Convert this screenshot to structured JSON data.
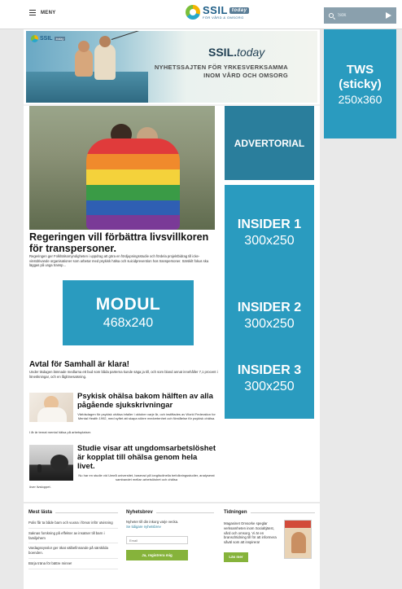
{
  "header": {
    "menu_label": "MENY",
    "logo_name": "SSIL",
    "logo_tag": "today",
    "logo_sub": "FÖR VÅRD & OMSORG",
    "search_placeholder": "Sök"
  },
  "hero_banner": {
    "mini_logo": "SSIL",
    "mini_tag": "today",
    "brand_main": "SSIL.",
    "brand_italic": "today",
    "tagline": "NYHETSSAJTEN FÖR YRKESVERKSAMMA INOM VÅRD OCH OMSORG"
  },
  "main_article": {
    "headline": "Regeringen vill förbättra livsvillkoren för transpersoner.",
    "lead": "Regeringen ger Folkhälsomyndigheten i uppdrag att göra en fördjupningsstudie och fördela projektbidrag till icke-vinstdrivande organisationer som arbetar med psykisk hälsa och suicidprevention hos transpersoner. Särskilt fokus ska läggas på unga transp..."
  },
  "modul_ad": {
    "title": "MODUL",
    "size": "468x240"
  },
  "article2": {
    "title": "Avtal för Samhall är klara!",
    "lead": "Under tisdagen lämnade medlarna ett bud som båda parterna kunde säga ja till, och som bland annat innehåller 7,1 procent i löneökningar, och en låglönesatsning."
  },
  "article3": {
    "title": "Psykisk ohälsa bakom hälften av alla pågående sjukskrivningar",
    "lead": "Världsdagen för psykisk ohälsa infaller i oktober varje år, och instiftades av World Federation for Mental Health 1992, med syftet att skapa större medvetenhet och förståelse för psykisk ohälsa.",
    "extra": "I år är temat mental hälsa på arbetsplatser."
  },
  "article4": {
    "title": "Studie visar att ungdomsarbetslöshet är kopplat till ohälsa genom hela livet.",
    "lead": "Nu har en studie vid Umeå universitet, baserad på longitudinella befolkningsstudier, analyserat sambandet mellan arbetslöshet och ohälsa",
    "extra": "över livsloppet."
  },
  "ads": {
    "advertorial": "ADVERTORIAL",
    "insider1": {
      "title": "INSIDER 1",
      "size": "300x250"
    },
    "insider2": {
      "title": "INSIDER 2",
      "size": "300x250"
    },
    "insider3": {
      "title": "INSIDER 3",
      "size": "300x250"
    },
    "tws": {
      "line1": "TWS",
      "line2": "(sticky)",
      "size": "250x360"
    }
  },
  "footer": {
    "most_read": {
      "title": "Mest lästa",
      "items": [
        "Polis får ta både barn och vuxna i förvar inför utvisning",
        "Saknas forskning på effekter av insatser till barn i familjehem",
        "Vardagssysslor ger ökat välbefinnande på särskilda boenden.",
        "Börja träna för bättre minne!"
      ]
    },
    "newsletter": {
      "title": "Nyhetsbrev",
      "text": "Nyheter till din inkorg varje vecka.",
      "link": "Se tidigare nyhetsbrev",
      "email_placeholder": "Email",
      "button": "Ja, registrera mig"
    },
    "magazine": {
      "title": "Tidningen",
      "text": "Magasinet Omsorke speglar verksamheten inom Socialtjänst, vård och omsorg. Vi är en branschtidning till för att informera såväl som att inspirera!",
      "button": "Läs mer"
    }
  },
  "colors": {
    "ad_blue": "#2a9bbf",
    "advertorial_blue": "#2a7e9c",
    "button_green": "#86b33b",
    "search_bg": "#8aa0ad"
  }
}
